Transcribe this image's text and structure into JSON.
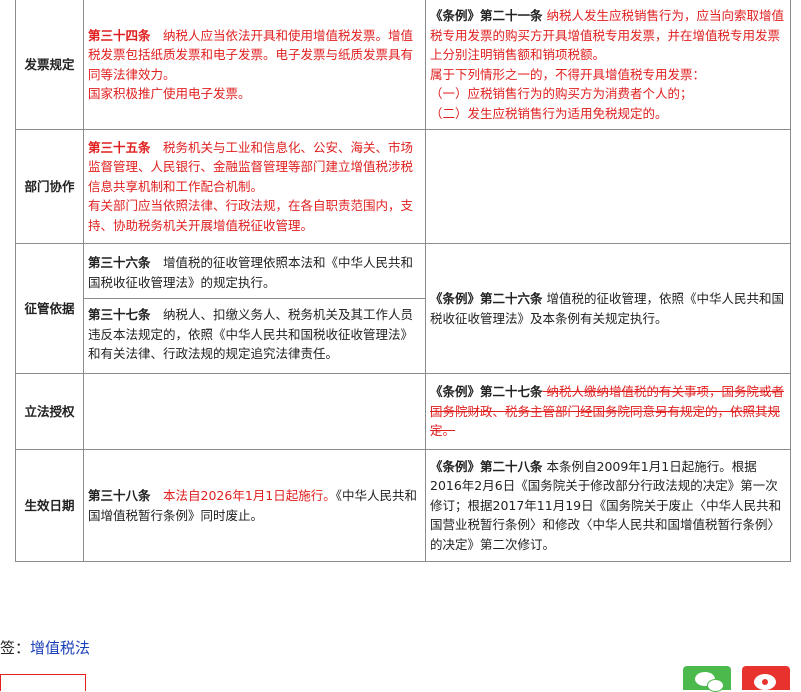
{
  "rows": [
    {
      "category": "发票规定",
      "law": [
        {
          "art": "第三十四条",
          "text": "　纳税人应当依法开具和使用增值税发票。增值税发票包括纸质发票和电子发票。电子发票与纸质发票具有同等法律效力。"
        },
        {
          "text": "国家积极推广使用电子发票。"
        }
      ],
      "reg": {
        "art": "《条例》第二十一条",
        "text": " 纳税人发生应税销售行为，应当向索取增值税专用发票的购买方开具增值税专用发票，并在增值税专用发票上分别注明销售额和销项税额。",
        "lines": [
          "属于下列情形之一的，不得开具增值税专用发票：",
          "（一）应税销售行为的购买方为消费者个人的；",
          "（二）发生应税销售行为适用免税规定的。"
        ]
      }
    },
    {
      "category": "部门协作",
      "law": [
        {
          "art": "第三十五条",
          "text": "　税务机关与工业和信息化、公安、海关、市场监督管理、人民银行、金融监督管理等部门建立增值税涉税信息共享机制和工作配合机制。"
        },
        {
          "text": "有关部门应当依照法律、行政法规，在各自职责范围内，支持、协助税务机关开展增值税征收管理。"
        }
      ]
    },
    {
      "category": "征管依据",
      "law": [
        {
          "art": "第三十六条",
          "text": "　增值税的征收管理依照本法和《中华人民共和国税收征收管理法》的规定执行。"
        },
        {
          "art": "第三十七条",
          "text": "　纳税人、扣缴义务人、税务机关及其工作人员违反本法规定的，依照《中华人民共和国税收征收管理法》和有关法律、行政法规的规定追究法律责任。"
        }
      ],
      "reg": {
        "art": "《条例》第二十六条",
        "text": " 增值税的征收管理，依照《中华人民共和国税收征收管理法》及本条例有关规定执行。"
      }
    },
    {
      "category": "立法授权",
      "reg": {
        "art": "《条例》第二十七条",
        "text": " 纳税人缴纳增值税的有关事项，国务院或者国务院财政、税务主管部门经国务院同意另有规定的，依照其规定。"
      }
    },
    {
      "category": "生效日期",
      "law": [
        {
          "art": "第三十八条",
          "red_text": "　本法自2026年1月1日起施行。",
          "text": "《中华人民共和国增值税暂行条例》同时废止。"
        }
      ],
      "reg": {
        "art": "《条例》第二十八条",
        "text": " 本条例自2009年1月1日起施行。根据2016年2月6日《国务院关于修改部分行政法规的决定》第一次修订；根据2017年11月19日《国务院关于废止〈中华人民共和国营业税暂行条例〉和修改〈中华人民共和国增值税暂行条例〉的决定》第二次修订。"
      }
    }
  ],
  "footer": {
    "tag_prefix": "签：",
    "tag_link": "增值税法"
  },
  "colors": {
    "red": "#e02020",
    "border": "#8c8c8c",
    "link": "#1a3fb8",
    "wechat": "#4cb94c",
    "weibo": "#e8322e"
  },
  "icons": [
    "wechat-share-icon",
    "weibo-share-icon"
  ]
}
